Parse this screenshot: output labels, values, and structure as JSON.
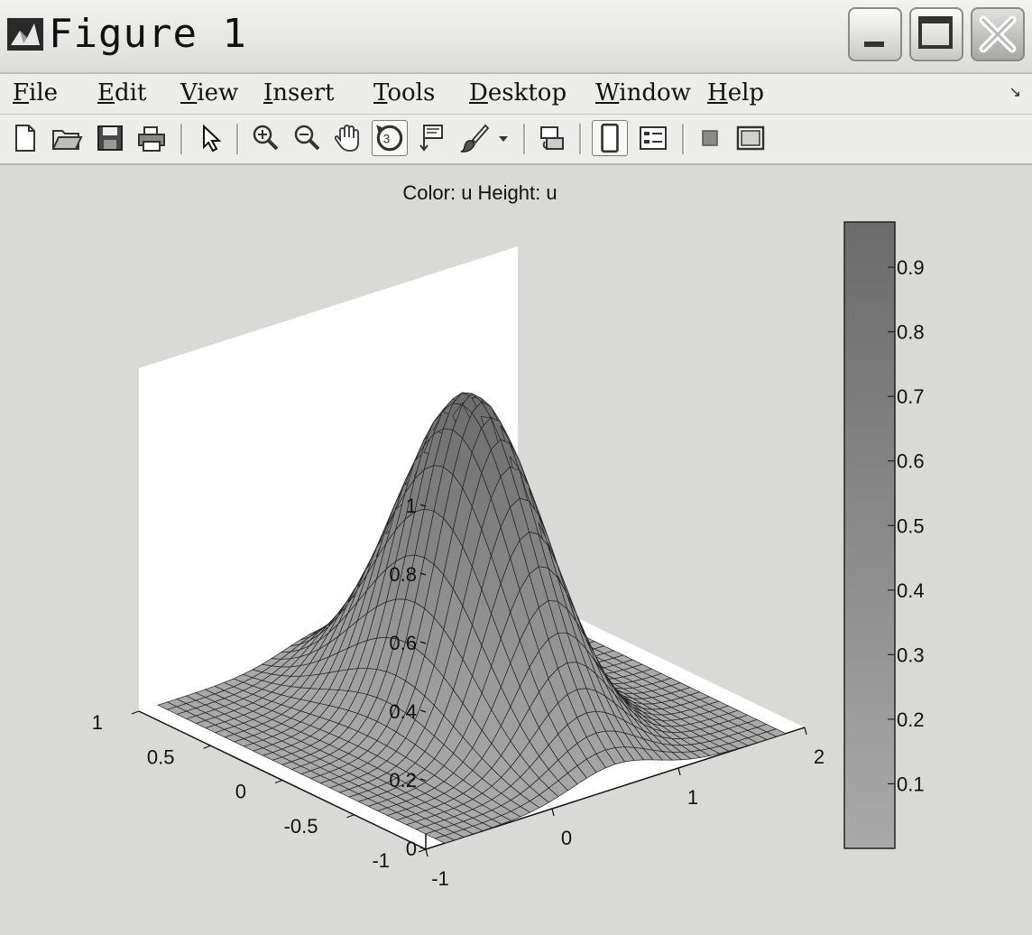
{
  "window": {
    "title": "Figure 1",
    "controls": {
      "minimize": "minimize",
      "maximize": "maximize",
      "close": "close"
    }
  },
  "menu": {
    "items": [
      {
        "label": "File",
        "key": "F"
      },
      {
        "label": "Edit",
        "key": "E"
      },
      {
        "label": "View",
        "key": "V"
      },
      {
        "label": "Insert",
        "key": "I"
      },
      {
        "label": "Tools",
        "key": "T"
      },
      {
        "label": "Desktop",
        "key": "D"
      },
      {
        "label": "Window",
        "key": "W"
      },
      {
        "label": "Help",
        "key": "H"
      }
    ]
  },
  "toolbar": {
    "buttons": [
      {
        "name": "new-figure-icon"
      },
      {
        "name": "open-file-icon"
      },
      {
        "name": "save-icon"
      },
      {
        "name": "print-icon"
      },
      {
        "name": "select-arrow-icon"
      },
      {
        "name": "zoom-in-icon"
      },
      {
        "name": "zoom-out-icon"
      },
      {
        "name": "pan-hand-icon"
      },
      {
        "name": "rotate-3d-icon",
        "pressed": true
      },
      {
        "name": "data-cursor-icon"
      },
      {
        "name": "brush-icon"
      },
      {
        "name": "link-plot-icon"
      },
      {
        "name": "colorbar-icon",
        "pressed": true
      },
      {
        "name": "legend-icon"
      },
      {
        "name": "hide-plot-tools-icon"
      },
      {
        "name": "show-plot-tools-icon"
      }
    ]
  },
  "chart_data": {
    "type": "surface",
    "title": "Color: u  Height: u",
    "function_shape": "single peak, maximum approx 0.95 near x=0.5, y=0",
    "x_axis": {
      "range": [
        -1,
        2
      ],
      "ticks": [
        "-1",
        "0",
        "1",
        "2"
      ]
    },
    "y_axis": {
      "range": [
        -1,
        1
      ],
      "ticks": [
        "-1",
        "-0.5",
        "0",
        "0.5",
        "1"
      ]
    },
    "z_axis": {
      "range": [
        0,
        1
      ],
      "ticks": [
        "0",
        "0.2",
        "0.4",
        "0.6",
        "0.8",
        "1"
      ]
    },
    "peak_value": 0.95,
    "colorbar": {
      "range": [
        0,
        0.97
      ],
      "ticks": [
        "0.1",
        "0.2",
        "0.3",
        "0.4",
        "0.5",
        "0.6",
        "0.7",
        "0.8",
        "0.9"
      ],
      "colormap": "gray",
      "low_color": "#a9a9a9",
      "high_color": "#6b6b6b"
    }
  }
}
